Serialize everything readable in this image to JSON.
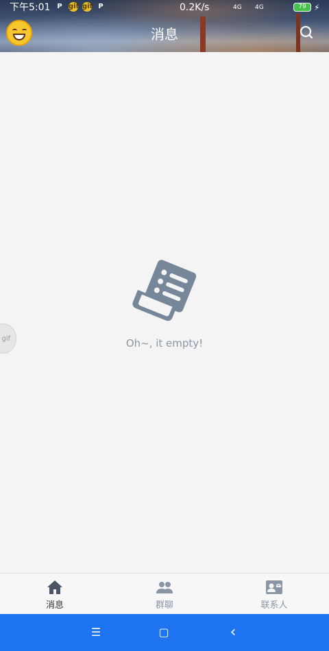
{
  "status_bar": {
    "time": "下午5:01",
    "speed": "0.2K/s",
    "net1": "4G",
    "net2": "4G",
    "battery": "79",
    "notif_icons": [
      "P",
      "gif",
      "gif",
      "P"
    ]
  },
  "header": {
    "title": "消息"
  },
  "empty_state": {
    "message": "Oh~, it empty!"
  },
  "side_tab": {
    "label": "gif"
  },
  "tabbar": {
    "items": [
      {
        "label": "消息",
        "icon": "home-icon",
        "active": true
      },
      {
        "label": "群聊",
        "icon": "group-icon",
        "active": false
      },
      {
        "label": "联系人",
        "icon": "contact-card-icon",
        "active": false
      }
    ]
  },
  "navbar": {
    "menu": "☰",
    "home": "▢",
    "back": "‹"
  },
  "colors": {
    "navbar": "#1e74f0",
    "icon_gray": "#8a96a6",
    "icon_dark": "#4a5566"
  }
}
